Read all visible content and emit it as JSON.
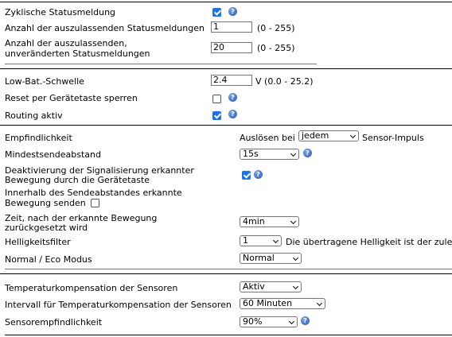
{
  "section1": {
    "zyklisch_label": "Zyklische Statusmeldung",
    "auszulassen_label": "Anzahl der auszulassenden Statusmeldungen",
    "auszulassen_value": "1",
    "auszulassen_range": "(0 - 255)",
    "unveraendert_label_line1": "Anzahl der auszulassenden,",
    "unveraendert_label_line2": "unveränderten Statusmeldungen",
    "unveraendert_value": "20",
    "unveraendert_range": "(0 - 255)"
  },
  "section2": {
    "lowbat_label": "Low-Bat.-Schwelle",
    "lowbat_value": "2.4",
    "lowbat_range": "V (0.0 - 25.2)",
    "reset_label": "Reset per Gerätetaste sperren",
    "routing_label": "Routing aktiv"
  },
  "section3": {
    "empfindlichkeit_label": "Empfindlichkeit",
    "ausloesen_prefix": "Auslösen bei",
    "ausloesen_value": "jedem",
    "ausloesen_suffix": "Sensor-Impuls",
    "mindest_label": "Mindestsendeabstand",
    "mindest_value": "15s",
    "deakt_label_line1": "Deaktivierung der Signalisierung erkannter",
    "deakt_label_line2": "Bewegung durch die Gerätetaste",
    "innerhalb_label_line1": "Innerhalb des Sendeabstandes erkannte",
    "innerhalb_label_line2": "Bewegung senden",
    "zeit_label_line1": "Zeit, nach der erkannte Bewegung",
    "zeit_label_line2": "zurückgesetzt wird",
    "zeit_value": "4min",
    "helligkeit_label": "Helligkeitsfilter",
    "helligkeit_value": "1",
    "helligkeit_note": "Die übertragene Helligkeit ist der zule",
    "mode_label": "Normal / Eco Modus",
    "mode_value": "Normal"
  },
  "section4": {
    "tempkomp_label": "Temperaturkompensation der Sensoren",
    "tempkomp_value": "Aktiv",
    "intervall_label": "Intervall für Temperaturkompensation der Sensoren",
    "intervall_value": "60 Minuten",
    "sensor_label": "Sensorempfindlichkeit",
    "sensor_value": "90%"
  },
  "checkboxes": {
    "zyklisch": true,
    "reset": false,
    "routing": true,
    "deaktivierung": true,
    "innerhalb": false
  },
  "help_glyph": "?",
  "icons": [
    "help-icon",
    "checkbox-checked",
    "checkbox-unchecked",
    "dropdown-arrow"
  ],
  "colors": {
    "checkbox_accent": "#1a73e8",
    "help_icon": "#2657b8"
  }
}
